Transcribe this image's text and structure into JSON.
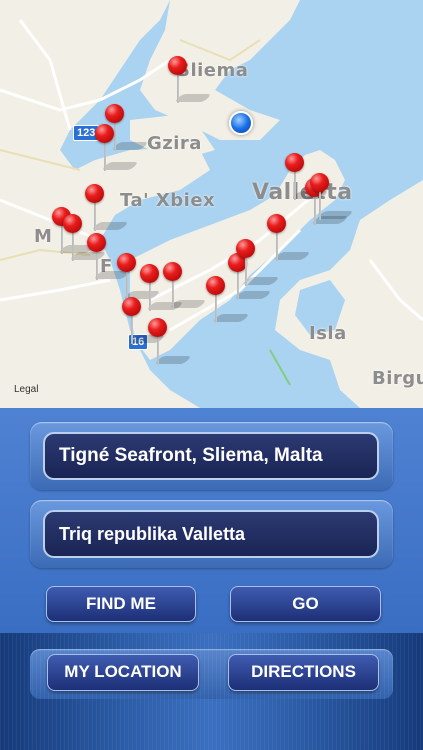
{
  "map": {
    "labels": {
      "sliema": "Sliema",
      "gzira": "Gzira",
      "ta_xbiex": "Ta' Xbiex",
      "valletta": "Valletta",
      "msida": "M",
      "floriana": "F",
      "isla": "Isla",
      "birgu": "Birgu"
    },
    "road_badges": {
      "upper": "123",
      "lower": "16"
    },
    "legal": "Legal",
    "colors": {
      "sea": "#a9d3f1",
      "land": "#f2efe6",
      "pin": "#e81d1d",
      "user_dot": "#1a6fe8"
    }
  },
  "form": {
    "from_value": "Tigné Seafront, Sliema, Malta",
    "to_value": "Triq republika Valletta",
    "find_me_label": "FIND ME",
    "go_label": "GO"
  },
  "toolbar": {
    "my_location_label": "MY LOCATION",
    "directions_label": "DIRECTIONS"
  }
}
